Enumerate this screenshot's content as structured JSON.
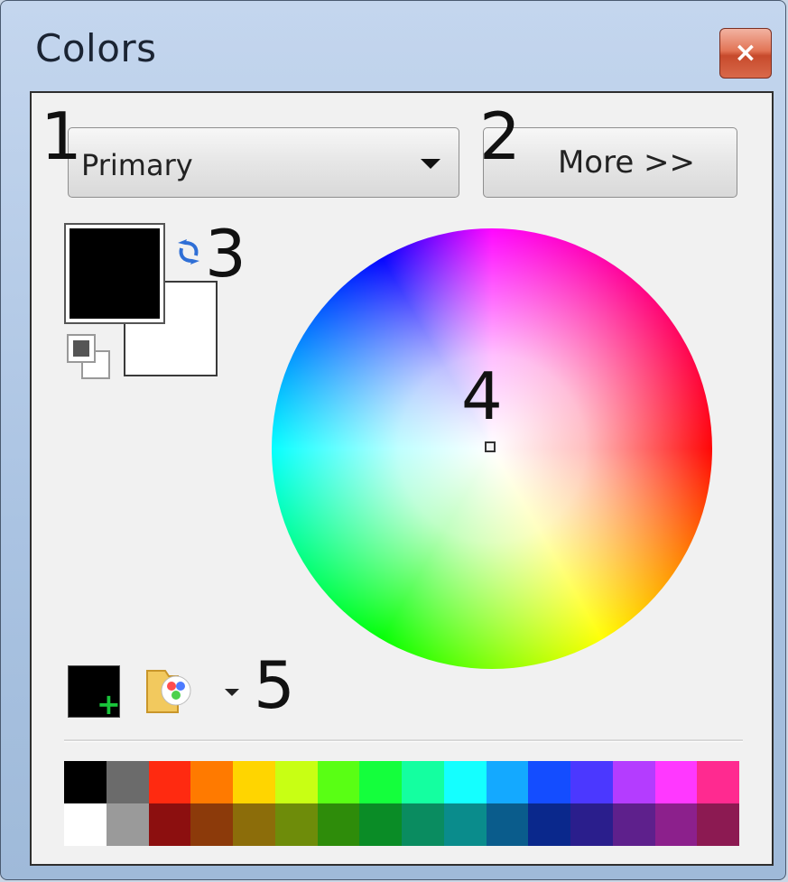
{
  "window": {
    "title": "Colors",
    "close_glyph": "×"
  },
  "annotations": [
    "1",
    "2",
    "3",
    "4",
    "5"
  ],
  "controls": {
    "mode_select_value": "Primary",
    "more_button_label": "More >>"
  },
  "colors": {
    "primary": "#000000",
    "secondary": "#ffffff"
  },
  "icons": {
    "swap": "swap-colors-icon",
    "reset": "reset-colors-icon",
    "add": "add-color-icon",
    "palette": "palette-icon",
    "palette_dropdown": "chevron-down-icon"
  },
  "palette": {
    "row1": [
      "#000000",
      "#6b6b6b",
      "#ff2a10",
      "#ff7a00",
      "#ffd500",
      "#c8ff14",
      "#59ff14",
      "#14ff3c",
      "#14ffa0",
      "#14ffff",
      "#14a9ff",
      "#144dff",
      "#4b38ff",
      "#b43cff",
      "#ff38ff",
      "#ff2a90"
    ],
    "row2": [
      "#ffffff",
      "#9a9a9a",
      "#8c0f0f",
      "#8c3a0a",
      "#8c6d0a",
      "#6e8c0a",
      "#2e8c0a",
      "#0a8c26",
      "#0a8c60",
      "#0a8c8c",
      "#0a5c8c",
      "#0a288c",
      "#2a1e8c",
      "#5e208c",
      "#8c208c",
      "#8c1a52"
    ]
  }
}
